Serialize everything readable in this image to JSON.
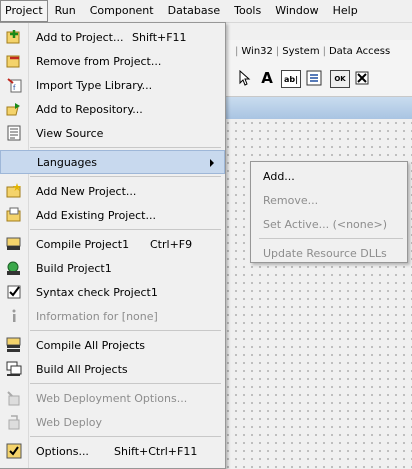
{
  "menubar": {
    "items": [
      "Project",
      "Run",
      "Component",
      "Database",
      "Tools",
      "Window",
      "Help"
    ]
  },
  "palette": {
    "tabs": [
      "Win32",
      "System",
      "Data Access"
    ]
  },
  "toolbar": {
    "icons": [
      "cursor-arrow-icon",
      "label-icon",
      "edit-icon",
      "memo-icon",
      "button-icon",
      "checkbox-icon"
    ],
    "label_glyph": "A",
    "edit_glyph": "ab|",
    "button_glyph": "OK"
  },
  "project_menu": {
    "items": [
      {
        "label": "Add to Project...",
        "shortcut": "Shift+F11",
        "icon": "add-to-project-icon",
        "disabled": false
      },
      {
        "label": "Remove from Project...",
        "shortcut": "",
        "icon": "remove-from-project-icon",
        "disabled": false
      },
      {
        "label": "Import Type Library...",
        "shortcut": "",
        "icon": "import-type-library-icon",
        "disabled": false
      },
      {
        "label": "Add to Repository...",
        "shortcut": "",
        "icon": "add-to-repository-icon",
        "disabled": false
      },
      {
        "label": "View Source",
        "shortcut": "",
        "icon": "view-source-icon",
        "disabled": false
      },
      {
        "label": "Languages",
        "shortcut": "",
        "icon": "",
        "disabled": false
      },
      {
        "label": "Add New Project...",
        "shortcut": "",
        "icon": "add-new-project-icon",
        "disabled": false
      },
      {
        "label": "Add Existing Project...",
        "shortcut": "",
        "icon": "add-existing-project-icon",
        "disabled": false
      },
      {
        "label": "Compile Project1",
        "shortcut": "Ctrl+F9",
        "icon": "compile-project-icon",
        "disabled": false
      },
      {
        "label": "Build Project1",
        "shortcut": "",
        "icon": "build-project-icon",
        "disabled": false
      },
      {
        "label": "Syntax check Project1",
        "shortcut": "",
        "icon": "syntax-check-icon",
        "disabled": false
      },
      {
        "label": "Information for [none]",
        "shortcut": "",
        "icon": "information-icon",
        "disabled": true
      },
      {
        "label": "Compile All Projects",
        "shortcut": "",
        "icon": "compile-all-icon",
        "disabled": false
      },
      {
        "label": "Build All Projects",
        "shortcut": "",
        "icon": "build-all-icon",
        "disabled": false
      },
      {
        "label": "Web Deployment Options...",
        "shortcut": "",
        "icon": "web-deployment-options-icon",
        "disabled": true
      },
      {
        "label": "Web Deploy",
        "shortcut": "",
        "icon": "web-deploy-icon",
        "disabled": true
      },
      {
        "label": "Options...",
        "shortcut": "Shift+Ctrl+F11",
        "icon": "options-icon",
        "disabled": false
      }
    ]
  },
  "languages_submenu": {
    "items": [
      {
        "label": "Add...",
        "disabled": false
      },
      {
        "label": "Remove...",
        "disabled": true
      },
      {
        "label": "Set Active... (<none>)",
        "disabled": true
      },
      {
        "label": "Update Resource DLLs",
        "disabled": true
      }
    ]
  },
  "colors": {
    "highlight": "#c8d9ee",
    "disabled_text": "#8d8d8d",
    "menu_bg": "#f0f0f0"
  }
}
